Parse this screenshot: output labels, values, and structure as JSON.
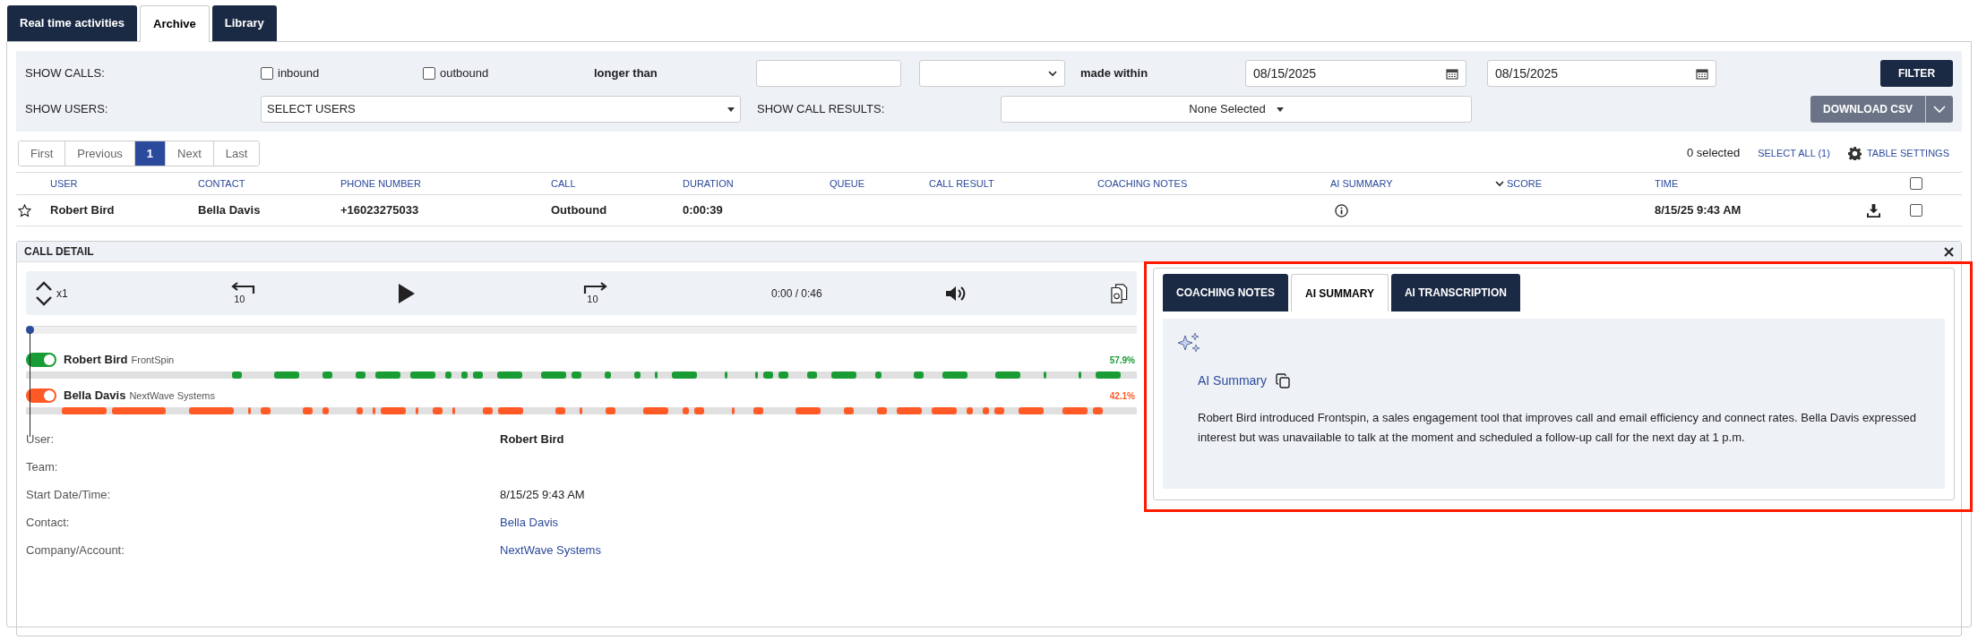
{
  "tabs": [
    {
      "label": "Real time activities",
      "selected": false
    },
    {
      "label": "Archive",
      "selected": true
    },
    {
      "label": "Library",
      "selected": false
    }
  ],
  "filters": {
    "show_calls_label": "SHOW CALLS:",
    "call_types": [
      {
        "label": "inbound",
        "checked": false
      },
      {
        "label": "outbound",
        "checked": false
      }
    ],
    "longer_than_label": "longer than",
    "made_within_label": "made within",
    "date_from": "08/15/2025",
    "date_to": "08/15/2025",
    "filter_button": "FILTER",
    "show_users_label": "SHOW USERS:",
    "users_select": "SELECT USERS",
    "show_call_results_label": "SHOW CALL RESULTS:",
    "call_results_select": "None Selected",
    "download_button": "DOWNLOAD CSV"
  },
  "pagination": [
    {
      "label": "First",
      "selected": false
    },
    {
      "label": "Previous",
      "selected": false
    },
    {
      "label": "1",
      "selected": true
    },
    {
      "label": "Next",
      "selected": false
    },
    {
      "label": "Last",
      "selected": false
    }
  ],
  "selection": {
    "count": "0 selected",
    "select_all": "SELECT ALL (1)",
    "table_settings": "TABLE SETTINGS"
  },
  "table": {
    "columns": [
      "USER",
      "CONTACT",
      "PHONE NUMBER",
      "CALL",
      "DURATION",
      "QUEUE",
      "CALL RESULT",
      "COACHING NOTES",
      "AI SUMMARY",
      "SCORE",
      "TIME"
    ],
    "header_checked": false,
    "rows": [
      {
        "starred": false,
        "user": "Robert Bird",
        "contact": "Bella Davis",
        "phone_number": "+16023275033",
        "call": "Outbound",
        "duration": "0:00:39",
        "time": "8/15/25 9:43 AM",
        "checked": false
      }
    ]
  },
  "call_detail": {
    "title": "CALL DETAIL",
    "player": {
      "speed": "x1",
      "skip_back": "10",
      "skip_forward": "10",
      "time": "0:00 / 0:46",
      "level": 0
    },
    "speakers": [
      {
        "name": "Robert Bird",
        "company": "FrontSpin",
        "share": "57.9%",
        "on": true,
        "color": "#1a9c35"
      },
      {
        "name": "Bella Davis",
        "company": "NextWave Systems",
        "share": "42.1%",
        "on": true,
        "color": "#ff5a26"
      }
    ],
    "details": [
      {
        "label": "User:",
        "value": "Robert Bird",
        "kind": "bold"
      },
      {
        "label": "Team:"
      },
      {
        "label": "Start Date/Time:",
        "value": "8/15/25 9:43 AM",
        "kind": "plain"
      },
      {
        "label": "Contact:",
        "value": "Bella Davis",
        "kind": "link"
      },
      {
        "label": "Company/Account:",
        "value": "NextWave Systems",
        "kind": "link"
      }
    ],
    "side_panel": {
      "tabs": [
        {
          "label": "COACHING NOTES",
          "selected": false
        },
        {
          "label": "AI SUMMARY",
          "selected": true
        },
        {
          "label": "AI TRANSCRIPTION",
          "selected": false
        }
      ],
      "summary_title": "AI Summary",
      "summary_text": "Robert Bird introduced Frontspin, a sales engagement tool that improves call and email efficiency and connect rates. Bella Davis expressed interest but was unavailable to talk at the moment and scheduled a follow-up call for the next day at 1 p.m."
    }
  }
}
